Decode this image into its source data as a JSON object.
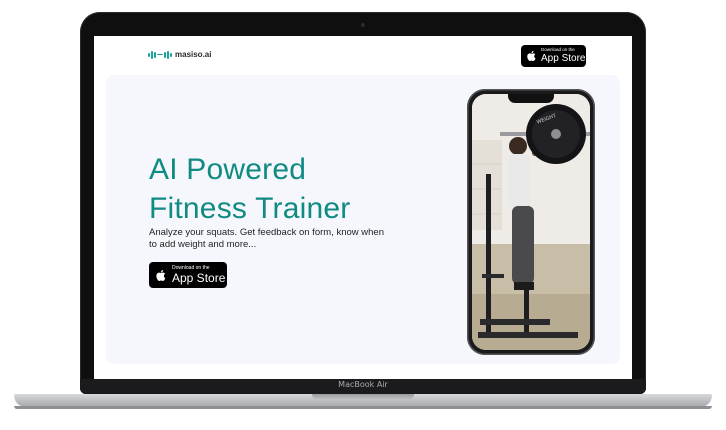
{
  "device": {
    "model_label": "MacBook Air"
  },
  "site": {
    "logo_text": "masiso.ai",
    "header_badge": {
      "small": "Download on the",
      "big": "App Store"
    },
    "hero": {
      "title_line1": "AI Powered",
      "title_line2": "Fitness Trainer",
      "subtitle": "Analyze your squats. Get feedback on form, know when to add weight and more...",
      "badge": {
        "small": "Download on the",
        "big": "App Store"
      }
    },
    "phone_video": {
      "plate_text": "WEIGHT"
    }
  },
  "colors": {
    "brand_teal": "#0f8b82",
    "logo_teal": "#19a39a",
    "hero_background": "#f6f7fc",
    "badge_black": "#000000"
  },
  "icons": [
    "apple-logo-icon",
    "barbell-logo-icon"
  ]
}
